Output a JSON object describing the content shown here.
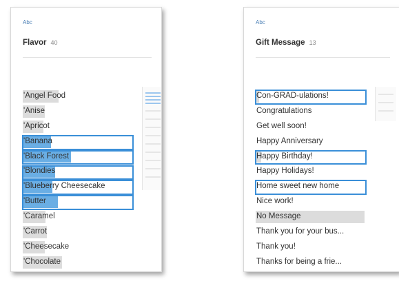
{
  "panels": [
    {
      "type_label": "Abc",
      "field_name": "Flavor",
      "field_count": "40",
      "values": [
        {
          "label": "'Angel Food",
          "bar": 0.33,
          "highlighted": false
        },
        {
          "label": "'Anise",
          "bar": 0.2,
          "highlighted": false
        },
        {
          "label": "'Apricot",
          "bar": 0.19,
          "highlighted": false
        },
        {
          "label": "'Banana",
          "bar": 0.26,
          "highlighted": true
        },
        {
          "label": "'Black Forest",
          "bar": 0.44,
          "highlighted": true
        },
        {
          "label": "'Blondies",
          "bar": 0.3,
          "highlighted": true
        },
        {
          "label": "'Blueberry Cheesecake",
          "bar": 0.27,
          "highlighted": true
        },
        {
          "label": "'Butter",
          "bar": 0.32,
          "highlighted": true
        },
        {
          "label": "'Caramel",
          "bar": 0.21,
          "highlighted": false
        },
        {
          "label": "'Carrot",
          "bar": 0.22,
          "highlighted": false
        },
        {
          "label": "'Cheesecake",
          "bar": 0.2,
          "highlighted": false
        },
        {
          "label": "'Chocolate",
          "bar": 0.36,
          "highlighted": false
        }
      ]
    },
    {
      "type_label": "Abc",
      "field_name": "Gift Message",
      "field_count": "13",
      "values": [
        {
          "label": "Con-GRAD-ulations!",
          "bar": 0.03,
          "highlighted": true
        },
        {
          "label": "Congratulations",
          "bar": 0.0,
          "highlighted": false
        },
        {
          "label": "Get well soon!",
          "bar": 0.0,
          "highlighted": false
        },
        {
          "label": "Happy Anniversary",
          "bar": 0.0,
          "highlighted": false
        },
        {
          "label": "Happy Birthday!",
          "bar": 0.05,
          "highlighted": true
        },
        {
          "label": "Happy Holidays!",
          "bar": 0.0,
          "highlighted": false
        },
        {
          "label": "Home sweet new home",
          "bar": 0.0,
          "highlighted": true
        },
        {
          "label": "Nice work!",
          "bar": 0.0,
          "highlighted": false
        },
        {
          "label": "No Message",
          "bar": 1.0,
          "highlighted": false
        },
        {
          "label": "Thank you for your bus...",
          "bar": 0.0,
          "highlighted": false
        },
        {
          "label": "Thank you!",
          "bar": 0.0,
          "highlighted": false
        },
        {
          "label": "Thanks for being a frie...",
          "bar": 0.0,
          "highlighted": false
        }
      ]
    }
  ],
  "colors": {
    "selected_bar": "#6aaee4",
    "bar": "#dcdcdc",
    "highlight_border": "#3a8fd8",
    "type_label": "#4a7fb5"
  }
}
